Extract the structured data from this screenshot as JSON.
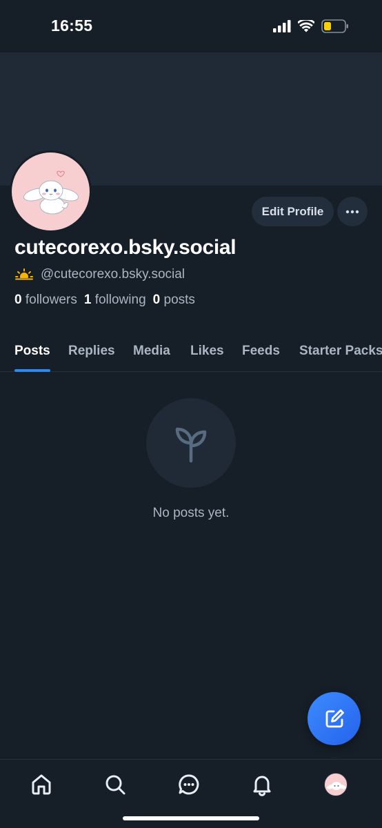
{
  "status_bar": {
    "time": "16:55",
    "icons": [
      "signal-icon",
      "wifi-icon",
      "battery-low-icon"
    ],
    "battery_color": "#f5d20a"
  },
  "profile": {
    "display_name": "cutecorexo.bsky.social",
    "handle": "@cutecorexo.bsky.social",
    "handle_emoji_icon": "sun-behind-cloud-icon",
    "edit_button": "Edit Profile",
    "more_icon": "ellipsis-icon",
    "stats": {
      "followers_count": "0",
      "followers_label": "followers",
      "following_count": "1",
      "following_label": "following",
      "posts_count": "0",
      "posts_label": "posts"
    }
  },
  "tabs": [
    {
      "label": "Posts",
      "active": true
    },
    {
      "label": "Replies",
      "active": false
    },
    {
      "label": "Media",
      "active": false
    },
    {
      "label": "Likes",
      "active": false
    },
    {
      "label": "Feeds",
      "active": false
    },
    {
      "label": "Starter Packs",
      "active": false
    }
  ],
  "empty_state": {
    "icon": "sprout-icon",
    "text": "No posts yet."
  },
  "fab": {
    "icon": "compose-icon"
  },
  "bottom_nav": [
    {
      "icon": "home-icon"
    },
    {
      "icon": "search-icon"
    },
    {
      "icon": "chat-icon"
    },
    {
      "icon": "bell-icon"
    },
    {
      "icon": "profile-avatar-icon"
    }
  ],
  "colors": {
    "background": "#161e27",
    "banner": "#1f2a36",
    "accent": "#2b8af0",
    "muted_text": "#aab6c3",
    "avatar_bg": "#f7cfd0"
  }
}
